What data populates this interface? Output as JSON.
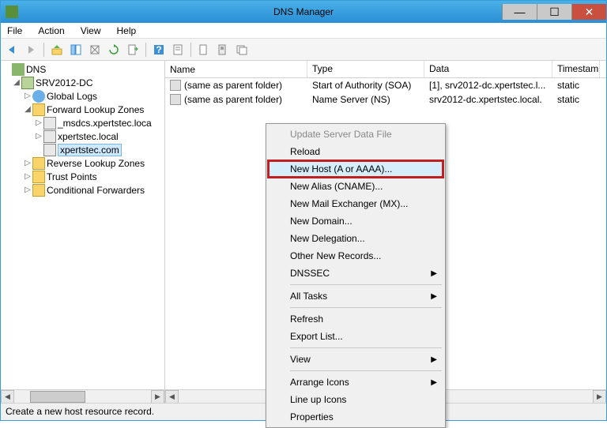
{
  "window": {
    "title": "DNS Manager"
  },
  "menus": [
    "File",
    "Action",
    "View",
    "Help"
  ],
  "tree": {
    "root": "DNS",
    "server": "SRV2012-DC",
    "nodes": {
      "global_logs": "Global Logs",
      "fwd_zones": "Forward Lookup Zones",
      "msdcs": "_msdcs.xpertstec.loca",
      "xlocal": "xpertstec.local",
      "xcom": "xpertstec.com",
      "rev_zones": "Reverse Lookup Zones",
      "trust": "Trust Points",
      "cond": "Conditional Forwarders"
    }
  },
  "columns": {
    "name": "Name",
    "type": "Type",
    "data": "Data",
    "ts": "Timestam"
  },
  "records": [
    {
      "name": "(same as parent folder)",
      "type": "Start of Authority (SOA)",
      "data": "[1], srv2012-dc.xpertstec.l...",
      "ts": "static"
    },
    {
      "name": "(same as parent folder)",
      "type": "Name Server (NS)",
      "data": "srv2012-dc.xpertstec.local.",
      "ts": "static"
    }
  ],
  "context_menu": {
    "update": "Update Server Data File",
    "reload": "Reload",
    "newhost": "New Host (A or AAAA)...",
    "newalias": "New Alias (CNAME)...",
    "newmx": "New Mail Exchanger (MX)...",
    "newdomain": "New Domain...",
    "newdeleg": "New Delegation...",
    "other": "Other New Records...",
    "dnssec": "DNSSEC",
    "alltasks": "All Tasks",
    "refresh": "Refresh",
    "export": "Export List...",
    "view": "View",
    "arrange": "Arrange Icons",
    "lineup": "Line up Icons",
    "props": "Properties"
  },
  "status": "Create a new host resource record."
}
